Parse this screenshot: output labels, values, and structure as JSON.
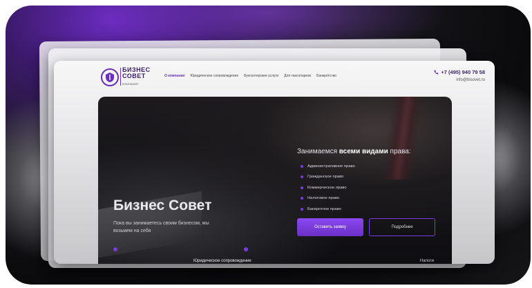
{
  "brand": {
    "line1": "БИЗНЕС",
    "line2": "СОВЕТ",
    "line3": "КОМПАНИЯ"
  },
  "nav": {
    "items": [
      "О компании",
      "Юридическое сопровождение",
      "Бухгалтерские услуги",
      "Для таксопарков",
      "Банкротство"
    ],
    "active_index": 0
  },
  "contacts": {
    "phone": "+7 (495) 940 79 58",
    "email": "info@bisovet.ru"
  },
  "hero": {
    "title": "Бизнес Совет",
    "subtitle": "Пока вы занимаетесь своим бизнесом, мы возьмем на себя",
    "right_heading_pre": "Занимаемся",
    "right_heading_bold": "всеми видами",
    "right_heading_post": "права:",
    "laws": [
      "Административное право",
      "Гражданское право",
      "Коммерческое право",
      "Налоговое право",
      "Банкротное право"
    ],
    "cta_primary": "Оставить заявку",
    "cta_secondary": "Подробнее"
  },
  "bottom_tabs": [
    "Бухгалтерия",
    "Юридическое сопровождение",
    "Налоги"
  ],
  "colors": {
    "accent": "#7a3be0",
    "brand_dark": "#3a1f6b"
  },
  "icons": {
    "logo": "shield-logo-icon",
    "phone": "phone-icon"
  }
}
